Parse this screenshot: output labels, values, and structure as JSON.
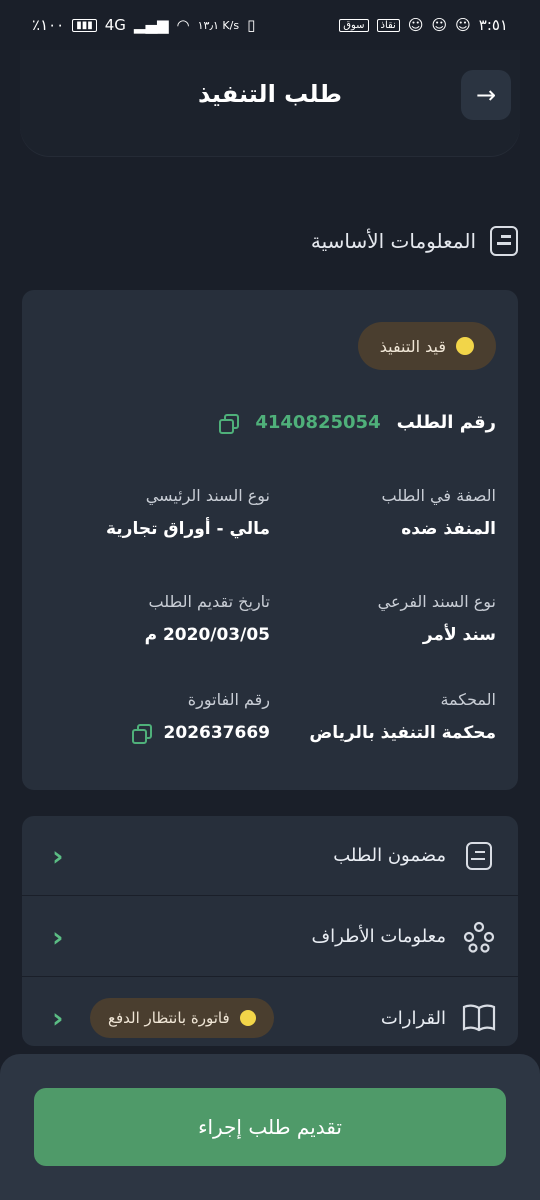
{
  "statusbar": {
    "time": "٣:٥١",
    "battery": "٪١٠٠",
    "net_speed": "١٣٫١ K/s",
    "network": "4G",
    "notif_app1": "نقاذ",
    "notif_app2": "سوق"
  },
  "header": {
    "title": "طلب التنفيذ"
  },
  "section": {
    "title": "المعلومات الأساسية"
  },
  "card": {
    "status_badge": "قيد التنفيذ",
    "request_number_label": "رقم الطلب",
    "request_number": "4140825054",
    "fields": [
      {
        "label": "الصفة في الطلب",
        "value": "المنفذ ضده"
      },
      {
        "label": "نوع السند الرئيسي",
        "value": "مالي - أوراق تجارية"
      },
      {
        "label": "نوع السند الفرعي",
        "value": "سند لأمر"
      },
      {
        "label": "تاريخ تقديم الطلب",
        "value": "2020/03/05 م"
      },
      {
        "label": "المحكمة",
        "value": "محكمة التنفيذ بالرياض"
      },
      {
        "label": "رقم الفاتورة",
        "value": "202637669"
      }
    ]
  },
  "list": {
    "items": [
      {
        "label": "مضمون الطلب"
      },
      {
        "label": "معلومات الأطراف"
      },
      {
        "label": "القرارات",
        "badge": "فاتورة بانتظار الدفع"
      }
    ]
  },
  "submit": {
    "label": "تقديم طلب إجراء"
  },
  "colors": {
    "accent": "#4f9a69",
    "status_dot": "#f2d549",
    "number": "#4fb07a"
  }
}
